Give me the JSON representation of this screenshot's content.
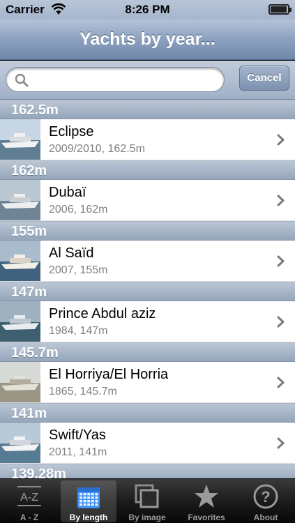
{
  "status_bar": {
    "carrier": "Carrier",
    "time": "8:26 PM",
    "battery_level": 0.95
  },
  "nav": {
    "title": "Yachts by year..."
  },
  "search": {
    "placeholder": "",
    "value": "",
    "cancel_label": "Cancel"
  },
  "sections": [
    {
      "header": "162.5m",
      "rows": [
        {
          "title": "Eclipse",
          "subtitle": "2009/2010, 162.5m"
        }
      ]
    },
    {
      "header": "162m",
      "rows": [
        {
          "title": "Dubaï",
          "subtitle": "2006, 162m"
        }
      ]
    },
    {
      "header": "155m",
      "rows": [
        {
          "title": "Al Saïd",
          "subtitle": "2007, 155m"
        }
      ]
    },
    {
      "header": "147m",
      "rows": [
        {
          "title": "Prince Abdul aziz",
          "subtitle": "1984, 147m"
        }
      ]
    },
    {
      "header": "145.7m",
      "rows": [
        {
          "title": "El Horriya/El Horria",
          "subtitle": "1865, 145.7m"
        }
      ]
    },
    {
      "header": "141m",
      "rows": [
        {
          "title": "Swift/Yas",
          "subtitle": "2011, 141m"
        }
      ]
    },
    {
      "header": "139.28m",
      "rows": []
    }
  ],
  "tab_bar": {
    "tabs": [
      {
        "label": "A - Z",
        "icon": "az-icon",
        "active": false
      },
      {
        "label": "By length",
        "icon": "calendar-icon",
        "active": true
      },
      {
        "label": "By image",
        "icon": "images-icon",
        "active": false
      },
      {
        "label": "Favorites",
        "icon": "star-icon",
        "active": false
      },
      {
        "label": "About",
        "icon": "question-icon",
        "active": false
      }
    ]
  },
  "colors": {
    "nav_tint": "#7d93b4",
    "section_header": "#a7b4c6",
    "active_tab_icon": "#3d8ff3"
  }
}
